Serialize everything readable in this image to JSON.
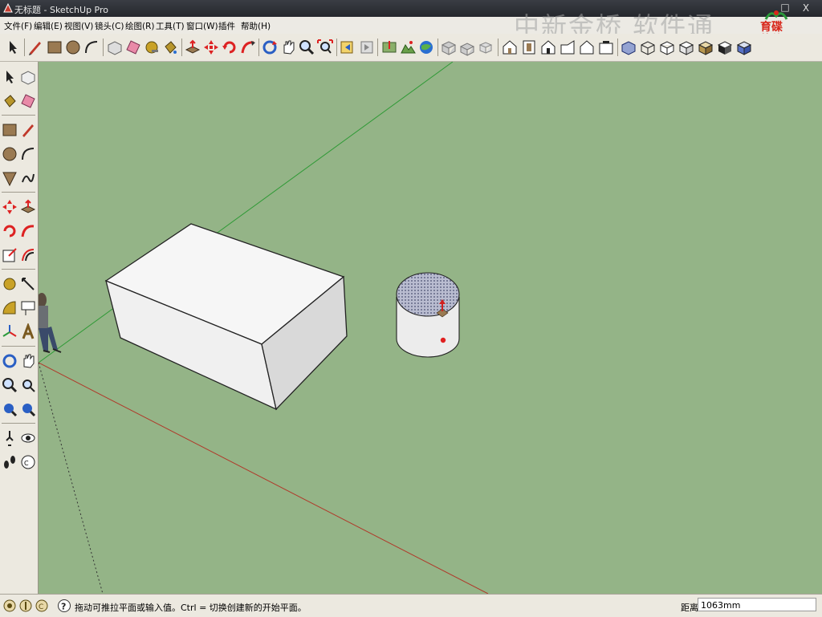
{
  "window": {
    "title": "无标题 - SketchUp Pro",
    "minimize": "_",
    "maximize": "□",
    "close": "X"
  },
  "menu": [
    "文件(F)",
    "编辑(E)",
    "视图(V)",
    "镜头(C)",
    "绘图(R)",
    "工具(T)",
    "窗口(W)",
    "插件",
    "帮助(H)"
  ],
  "watermark": "中新金桥 软件通",
  "logo_text": "育碟\n软件",
  "toolbar_icons": [
    "select-icon",
    "pencil-icon",
    "rectangle-icon",
    "circle-icon",
    "arc-icon",
    "make-component-icon",
    "eraser-icon",
    "tape-measure-icon",
    "paint-bucket-icon",
    "push-pull-icon",
    "move-icon",
    "rotate-icon",
    "follow-me-icon",
    "orbit-icon",
    "pan-icon",
    "zoom-icon",
    "zoom-extents-icon",
    "previous-view-icon",
    "next-view-icon",
    "add-location-icon",
    "toggle-terrain-icon",
    "photo-textures-icon",
    "get-models-icon",
    "share-model-icon",
    "share-component-icon",
    "iso-view-icon",
    "top-view-icon",
    "front-view-icon",
    "right-view-icon",
    "back-view-icon",
    "left-view-icon",
    "xray-icon",
    "wireframe-icon",
    "hidden-line-icon",
    "shaded-icon",
    "shaded-textures-icon",
    "monochrome-icon"
  ],
  "status": {
    "hint": "拖动可推拉平面或输入值。Ctrl = 切换创建新的开始平面。",
    "vcb_label": "距离",
    "vcb_value": "1063mm"
  },
  "colors": {
    "viewport_bg": "#94b487",
    "red_axis": "#b0392a",
    "green_axis": "#2f9a36",
    "face": "#f4f4f4",
    "face_side": "#d8d8d8"
  }
}
